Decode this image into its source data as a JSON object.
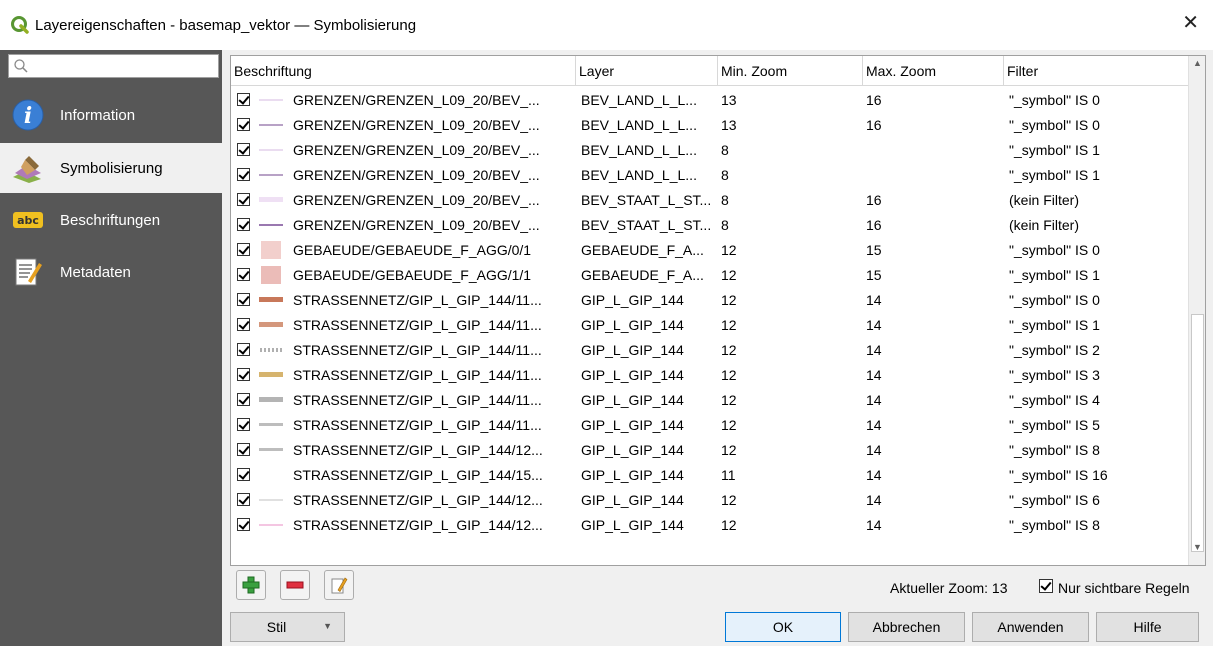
{
  "window": {
    "title": "Layereigenschaften - basemap_vektor — Symbolisierung",
    "close_label": "✕"
  },
  "sidebar": {
    "search_placeholder": "",
    "items": [
      {
        "label": "Information",
        "icon": "info-icon"
      },
      {
        "label": "Symbolisierung",
        "icon": "paintbrush-icon",
        "active": true
      },
      {
        "label": "Beschriftungen",
        "icon": "abc-label-icon"
      },
      {
        "label": "Metadaten",
        "icon": "metadata-icon"
      }
    ]
  },
  "table": {
    "headers": [
      "Beschriftung",
      "Layer",
      "Min. Zoom",
      "Max. Zoom",
      "Filter"
    ],
    "rows": [
      {
        "label": "GRENZEN/GRENZEN_L09_20/BEV_...",
        "layer": "BEV_LAND_L_L...",
        "min": "13",
        "max": "16",
        "filter": "\"_symbol\" IS 0",
        "sym": "line",
        "color": "#eadcf0"
      },
      {
        "label": "GRENZEN/GRENZEN_L09_20/BEV_...",
        "layer": "BEV_LAND_L_L...",
        "min": "13",
        "max": "16",
        "filter": "\"_symbol\" IS 0",
        "sym": "line",
        "color": "#b8a2c6"
      },
      {
        "label": "GRENZEN/GRENZEN_L09_20/BEV_...",
        "layer": "BEV_LAND_L_L...",
        "min": "8",
        "max": "",
        "filter": "\"_symbol\" IS 1",
        "sym": "line",
        "color": "#eadcf0"
      },
      {
        "label": "GRENZEN/GRENZEN_L09_20/BEV_...",
        "layer": "BEV_LAND_L_L...",
        "min": "8",
        "max": "",
        "filter": "\"_symbol\" IS 1",
        "sym": "line",
        "color": "#b8a2c6"
      },
      {
        "label": "GRENZEN/GRENZEN_L09_20/BEV_...",
        "layer": "BEV_STAAT_L_ST...",
        "min": "8",
        "max": "16",
        "filter": "(kein Filter)",
        "sym": "thick",
        "color": "#efe0f4"
      },
      {
        "label": "GRENZEN/GRENZEN_L09_20/BEV_...",
        "layer": "BEV_STAAT_L_ST...",
        "min": "8",
        "max": "16",
        "filter": "(kein Filter)",
        "sym": "line",
        "color": "#9a78b0"
      },
      {
        "label": "GEBAEUDE/GEBAEUDE_F_AGG/0/1",
        "layer": "GEBAEUDE_F_A...",
        "min": "12",
        "max": "15",
        "filter": "\"_symbol\" IS 0",
        "sym": "fill",
        "color": "#f2cfcc"
      },
      {
        "label": "GEBAEUDE/GEBAEUDE_F_AGG/1/1",
        "layer": "GEBAEUDE_F_A...",
        "min": "12",
        "max": "15",
        "filter": "\"_symbol\" IS 1",
        "sym": "fill",
        "color": "#ebbcb8"
      },
      {
        "label": "STRASSENNETZ/GIP_L_GIP_144/11...",
        "layer": "GIP_L_GIP_144",
        "min": "12",
        "max": "14",
        "filter": "\"_symbol\" IS 0",
        "sym": "thick",
        "color": "#c8785a"
      },
      {
        "label": "STRASSENNETZ/GIP_L_GIP_144/11...",
        "layer": "GIP_L_GIP_144",
        "min": "12",
        "max": "14",
        "filter": "\"_symbol\" IS 1",
        "sym": "thick",
        "color": "#d4977c"
      },
      {
        "label": "STRASSENNETZ/GIP_L_GIP_144/11...",
        "layer": "GIP_L_GIP_144",
        "min": "12",
        "max": "14",
        "filter": "\"_symbol\" IS 2",
        "sym": "dashed",
        "color": "#b0b0b0"
      },
      {
        "label": "STRASSENNETZ/GIP_L_GIP_144/11...",
        "layer": "GIP_L_GIP_144",
        "min": "12",
        "max": "14",
        "filter": "\"_symbol\" IS 3",
        "sym": "thick",
        "color": "#d6b46e"
      },
      {
        "label": "STRASSENNETZ/GIP_L_GIP_144/11...",
        "layer": "GIP_L_GIP_144",
        "min": "12",
        "max": "14",
        "filter": "\"_symbol\" IS 4",
        "sym": "thick",
        "color": "#b4b4b4"
      },
      {
        "label": "STRASSENNETZ/GIP_L_GIP_144/11...",
        "layer": "GIP_L_GIP_144",
        "min": "12",
        "max": "14",
        "filter": "\"_symbol\" IS 5",
        "sym": "medium",
        "color": "#bdbdbd"
      },
      {
        "label": "STRASSENNETZ/GIP_L_GIP_144/12...",
        "layer": "GIP_L_GIP_144",
        "min": "12",
        "max": "14",
        "filter": "\"_symbol\" IS 8",
        "sym": "medium",
        "color": "#bdbdbd"
      },
      {
        "label": "STRASSENNETZ/GIP_L_GIP_144/15...",
        "layer": "GIP_L_GIP_144",
        "min": "11",
        "max": "14",
        "filter": "\"_symbol\" IS 16",
        "sym": "none",
        "color": "#ffffff"
      },
      {
        "label": "STRASSENNETZ/GIP_L_GIP_144/12...",
        "layer": "GIP_L_GIP_144",
        "min": "12",
        "max": "14",
        "filter": "\"_symbol\" IS 6",
        "sym": "line",
        "color": "#e0e0e0"
      },
      {
        "label": "STRASSENNETZ/GIP_L_GIP_144/12...",
        "layer": "GIP_L_GIP_144",
        "min": "12",
        "max": "14",
        "filter": "\"_symbol\" IS 8",
        "sym": "line",
        "color": "#f4c6e2"
      }
    ]
  },
  "toolbar": {
    "add_icon": "add-rule-icon",
    "remove_icon": "remove-rule-icon",
    "edit_icon": "edit-rule-icon"
  },
  "zoom": {
    "label": "Aktueller Zoom: 13",
    "checkbox_label": "Nur sichtbare Regeln",
    "checked": true
  },
  "buttons": {
    "stil": "Stil",
    "ok": "OK",
    "cancel": "Abbrechen",
    "apply": "Anwenden",
    "help": "Hilfe"
  }
}
